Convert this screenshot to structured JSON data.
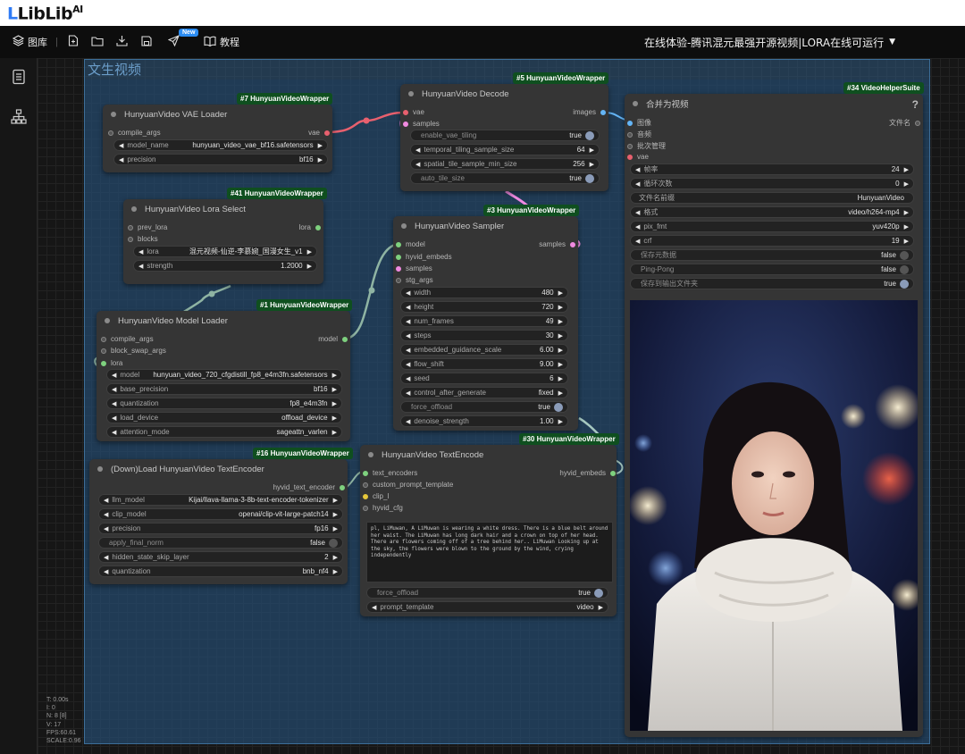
{
  "brand": {
    "logo_text": "LibLib",
    "logo_suffix": "AI"
  },
  "topbar": {
    "gallery_label": "图库",
    "tutorial_label": "教程",
    "new_badge": "New",
    "workflow_title": "在线体验-腾讯混元最强开源视频|LORA在线可运行"
  },
  "stats": [
    "T: 0.00s",
    "I: 0",
    "N: 8 [8]",
    "V: 17",
    "FPS:60.61",
    "SCALE:0.96"
  ],
  "group": {
    "title": "文生视频"
  },
  "nodes": {
    "vae_loader": {
      "tag": "#7 HunyuanVideoWrapper",
      "title": "HunyuanVideo VAE Loader",
      "inputs": [
        "compile_args"
      ],
      "outputs": [
        "vae"
      ],
      "widgets": [
        {
          "label": "model_name",
          "value": "hunyuan_video_vae_bf16.safetensors"
        },
        {
          "label": "precision",
          "value": "bf16"
        }
      ]
    },
    "lora_select": {
      "tag": "#41 HunyuanVideoWrapper",
      "title": "HunyuanVideo Lora Select",
      "inputs": [
        "prev_lora",
        "blocks"
      ],
      "outputs": [
        "lora"
      ],
      "widgets": [
        {
          "label": "lora",
          "value": "混元视频-仙逆-李慕婉_国漫女生_v1"
        },
        {
          "label": "strength",
          "value": "1.2000"
        }
      ]
    },
    "model_loader": {
      "tag": "#1 HunyuanVideoWrapper",
      "title": "HunyuanVideo Model Loader",
      "inputs": [
        "compile_args",
        "block_swap_args",
        "lora"
      ],
      "outputs": [
        "model"
      ],
      "widgets": [
        {
          "label": "model",
          "value": "hunyuan_video_720_cfgdistill_fp8_e4m3fn.safetensors"
        },
        {
          "label": "base_precision",
          "value": "bf16"
        },
        {
          "label": "quantization",
          "value": "fp8_e4m3fn"
        },
        {
          "label": "load_device",
          "value": "offload_device"
        },
        {
          "label": "attention_mode",
          "value": "sageattn_varlen"
        }
      ]
    },
    "text_encoder_loader": {
      "tag": "#16 HunyuanVideoWrapper",
      "title": "(Down)Load HunyuanVideo TextEncoder",
      "outputs": [
        "hyvid_text_encoder"
      ],
      "widgets": [
        {
          "label": "llm_model",
          "value": "Kijai/llava-llama-3-8b-text-encoder-tokenizer",
          "kind": "combo"
        },
        {
          "label": "clip_model",
          "value": "openai/clip-vit-large-patch14",
          "kind": "combo"
        },
        {
          "label": "precision",
          "value": "fp16",
          "kind": "combo"
        },
        {
          "label": "apply_final_norm",
          "value": "false",
          "kind": "toggle",
          "on": false
        },
        {
          "label": "hidden_state_skip_layer",
          "value": "2",
          "kind": "combo"
        },
        {
          "label": "quantization",
          "value": "bnb_nf4",
          "kind": "combo"
        }
      ]
    },
    "decode": {
      "tag": "#5 HunyuanVideoWrapper",
      "title": "HunyuanVideo Decode",
      "inputs": [
        "vae",
        "samples"
      ],
      "outputs": [
        "images"
      ],
      "widgets": [
        {
          "label": "enable_vae_tiling",
          "value": "true",
          "kind": "toggle",
          "on": true
        },
        {
          "label": "temporal_tiling_sample_size",
          "value": "64",
          "kind": "combo"
        },
        {
          "label": "spatial_tile_sample_min_size",
          "value": "256",
          "kind": "combo"
        },
        {
          "label": "auto_tile_size",
          "value": "true",
          "kind": "toggle",
          "on": true
        }
      ]
    },
    "sampler": {
      "tag": "#3 HunyuanVideoWrapper",
      "title": "HunyuanVideo Sampler",
      "inputs": [
        "model",
        "hyvid_embeds",
        "samples",
        "stg_args"
      ],
      "outputs": [
        "samples"
      ],
      "widgets": [
        {
          "label": "width",
          "value": "480",
          "kind": "combo"
        },
        {
          "label": "height",
          "value": "720",
          "kind": "combo"
        },
        {
          "label": "num_frames",
          "value": "49",
          "kind": "combo"
        },
        {
          "label": "steps",
          "value": "30",
          "kind": "combo"
        },
        {
          "label": "embedded_guidance_scale",
          "value": "6.00",
          "kind": "combo"
        },
        {
          "label": "flow_shift",
          "value": "9.00",
          "kind": "combo"
        },
        {
          "label": "seed",
          "value": "6",
          "kind": "combo"
        },
        {
          "label": "control_after_generate",
          "value": "fixed",
          "kind": "combo"
        },
        {
          "label": "force_offload",
          "value": "true",
          "kind": "toggle",
          "on": true
        },
        {
          "label": "denoise_strength",
          "value": "1.00",
          "kind": "combo"
        }
      ]
    },
    "text_encode": {
      "tag": "#30 HunyuanVideoWrapper",
      "title": "HunyuanVideo TextEncode",
      "inputs": [
        "text_encoders",
        "custom_prompt_template",
        "clip_l",
        "hyvid_cfg"
      ],
      "outputs": [
        "hyvid_embeds"
      ],
      "prompt": "pl, LiMuwan, A LiMuwan is wearing a white dress. There is a blue belt around her waist. The LiMuwan has long dark hair and a crown on top of her head. There are flowers coming off of a tree behind her.. LiMuwan Looking up at the sky, the flowers were blown to the ground by the wind, crying independently",
      "widgets": [
        {
          "label": "force_offload",
          "value": "true",
          "kind": "toggle",
          "on": true
        },
        {
          "label": "prompt_template",
          "value": "video",
          "kind": "combo"
        }
      ]
    },
    "video_combine": {
      "tag": "#34 VideoHelperSuite",
      "title": "合并为视频",
      "help": "?",
      "inputs": [
        "图像",
        "音频",
        "批次管理",
        "vae"
      ],
      "outputs": [
        "文件名"
      ],
      "widgets": [
        {
          "label": "帧率",
          "value": "24",
          "kind": "combo"
        },
        {
          "label": "循环次数",
          "value": "0",
          "kind": "combo"
        },
        {
          "label": "文件名前缀",
          "value": "HunyuanVideo",
          "kind": "text"
        },
        {
          "label": "格式",
          "value": "video/h264-mp4",
          "kind": "combo"
        },
        {
          "label": "pix_fmt",
          "value": "yuv420p",
          "kind": "combo"
        },
        {
          "label": "crf",
          "value": "19",
          "kind": "combo"
        },
        {
          "label": "保存元数据",
          "value": "false",
          "kind": "toggle",
          "on": false
        },
        {
          "label": "Ping-Pong",
          "value": "false",
          "kind": "toggle",
          "on": false
        },
        {
          "label": "保存到输出文件夹",
          "value": "true",
          "kind": "toggle",
          "on": true
        }
      ]
    }
  },
  "colors": {
    "vae_link": "#e8606e",
    "model_link": "#8fb4a3",
    "samples_link": "#f08ae0",
    "embeds_link": "#a6c8c0",
    "node_bg": "#353535",
    "tag_bg": "#0f4f1f",
    "group_border": "#3d6e98"
  }
}
